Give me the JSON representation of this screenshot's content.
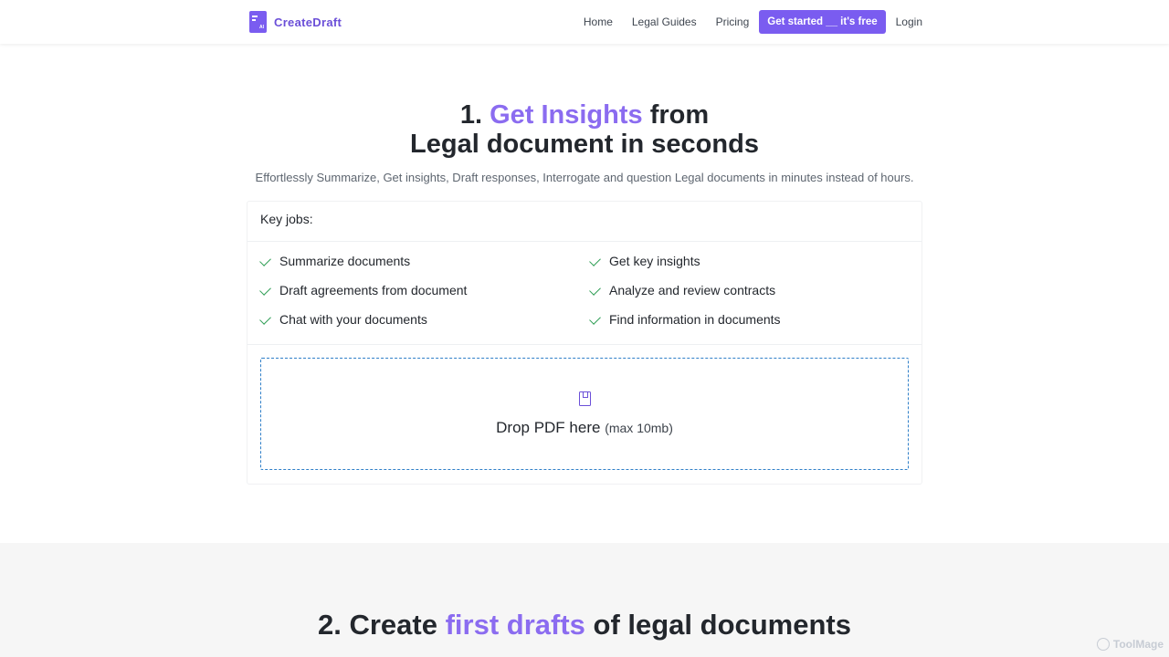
{
  "nav": {
    "logo_text": "CreateDraft",
    "logo_mark_text": "AI",
    "links": [
      "Home",
      "Legal Guides",
      "Pricing"
    ],
    "cta": "Get started __ it's free",
    "login": "Login"
  },
  "hero": {
    "title_prefix": "1. ",
    "title_accent": "Get Insights",
    "title_rest": " from",
    "title_line2": "Legal document in seconds",
    "subtitle": "Effortlessly Summarize, Get insights, Draft responses, Interrogate and question Legal documents in minutes instead of hours."
  },
  "jobs": {
    "header": "Key jobs:",
    "left": [
      "Summarize documents",
      "Draft agreements from document",
      "Chat with your documents"
    ],
    "right": [
      "Get key insights",
      "Analyze and review contracts",
      "Find information in documents"
    ]
  },
  "dropzone": {
    "icon": "document-icon",
    "text": "Drop PDF here",
    "hint": "(max 10mb)"
  },
  "section2": {
    "title_prefix": "2. Create ",
    "title_accent": "first drafts",
    "title_rest": " of legal documents"
  },
  "watermark": "ToolMage",
  "colors": {
    "accent": "#8b6cf0",
    "brand": "#7a5cf0",
    "check": "#2f9e55",
    "dropzone_border": "#2f7fc8"
  }
}
